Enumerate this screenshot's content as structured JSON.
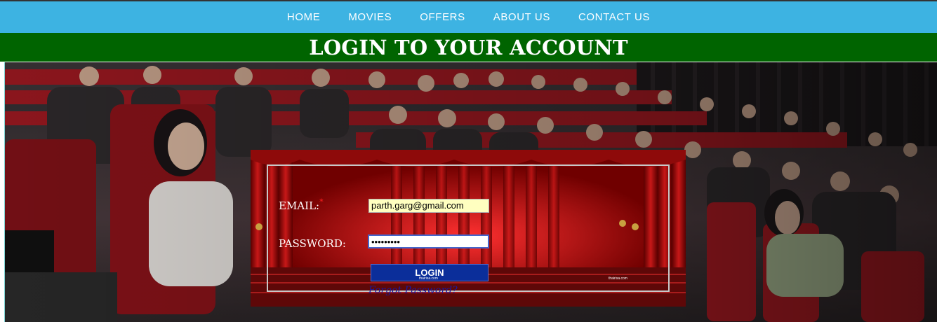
{
  "nav": {
    "items": [
      {
        "label": "HOME"
      },
      {
        "label": "MOVIES"
      },
      {
        "label": "OFFERS"
      },
      {
        "label": "ABOUT US"
      },
      {
        "label": "CONTACT US"
      }
    ]
  },
  "header": {
    "title": "LOGIN TO YOUR ACCOUNT"
  },
  "form": {
    "email_label": "EMAIL:",
    "required_mark": "*",
    "email_value": "parth.garg@gmail.com",
    "password_label": "PASSWORD:",
    "password_value": "•••••••••",
    "login_label": "LOGIN",
    "forgot_label": "Forgot Password?",
    "watermark_1": "thairisa.com",
    "watermark_2": "thairisa.com"
  },
  "colors": {
    "navbar": "#3db3e2",
    "title_bar": "#006400",
    "login_button": "#0b2e9a",
    "email_bg": "#ffffc0"
  }
}
